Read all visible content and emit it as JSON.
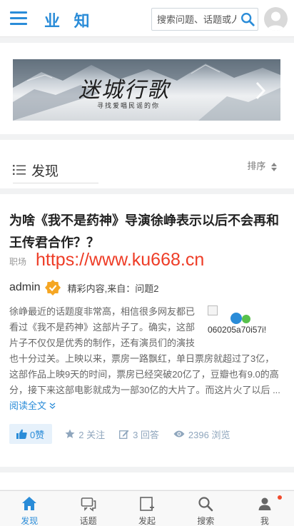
{
  "header": {
    "logo": "业 知",
    "search_placeholder": "搜索问题、话题或人",
    "menu_icon": "hamburger-icon",
    "search_icon": "search-icon",
    "avatar_icon": "user-avatar"
  },
  "banner": {
    "title": "迷城行歌",
    "subtitle": "寻找爱唱民谣的你"
  },
  "discover": {
    "title": "发现",
    "sort_label": "排序"
  },
  "article": {
    "title": "为啥《我不是药神》导演徐峥表示以后不会再和王传君合作？？",
    "category": "职场",
    "watermark": "https://www.ku668.cn",
    "author": "admin",
    "source": "精彩内容,来自：问题2",
    "body": "徐峥最近的话题度非常高，相信很多网友都已看过《我不是药神》这部片子了。确实，这部片子不仅仅是优秀的制作，还有演员们的演技也十分过关。上映以来，票房一路飘红，单日票房就超过了3亿，这部作品上映9天的时间，票房已经突破20亿了，豆瓣也有9.0的高分，接下来这部电影就成为一部30亿的大片了。而这片火了以后 ...",
    "read_more": "阅读全文",
    "image_alt": "060205a70i57i!",
    "likes": "0赞",
    "follows": "2 关注",
    "answers": "3 回答",
    "views": "2396 浏览"
  },
  "nav": {
    "items": [
      {
        "label": "发现",
        "icon": "home-icon",
        "active": true
      },
      {
        "label": "话题",
        "icon": "topic-icon",
        "active": false
      },
      {
        "label": "发起",
        "icon": "publish-icon",
        "active": false
      },
      {
        "label": "搜索",
        "icon": "search-icon",
        "active": false
      },
      {
        "label": "我",
        "icon": "user-icon",
        "active": false
      }
    ]
  },
  "colors": {
    "accent": "#2a8cd8",
    "watermark": "#ee3c26",
    "badge": "#f5a623"
  }
}
